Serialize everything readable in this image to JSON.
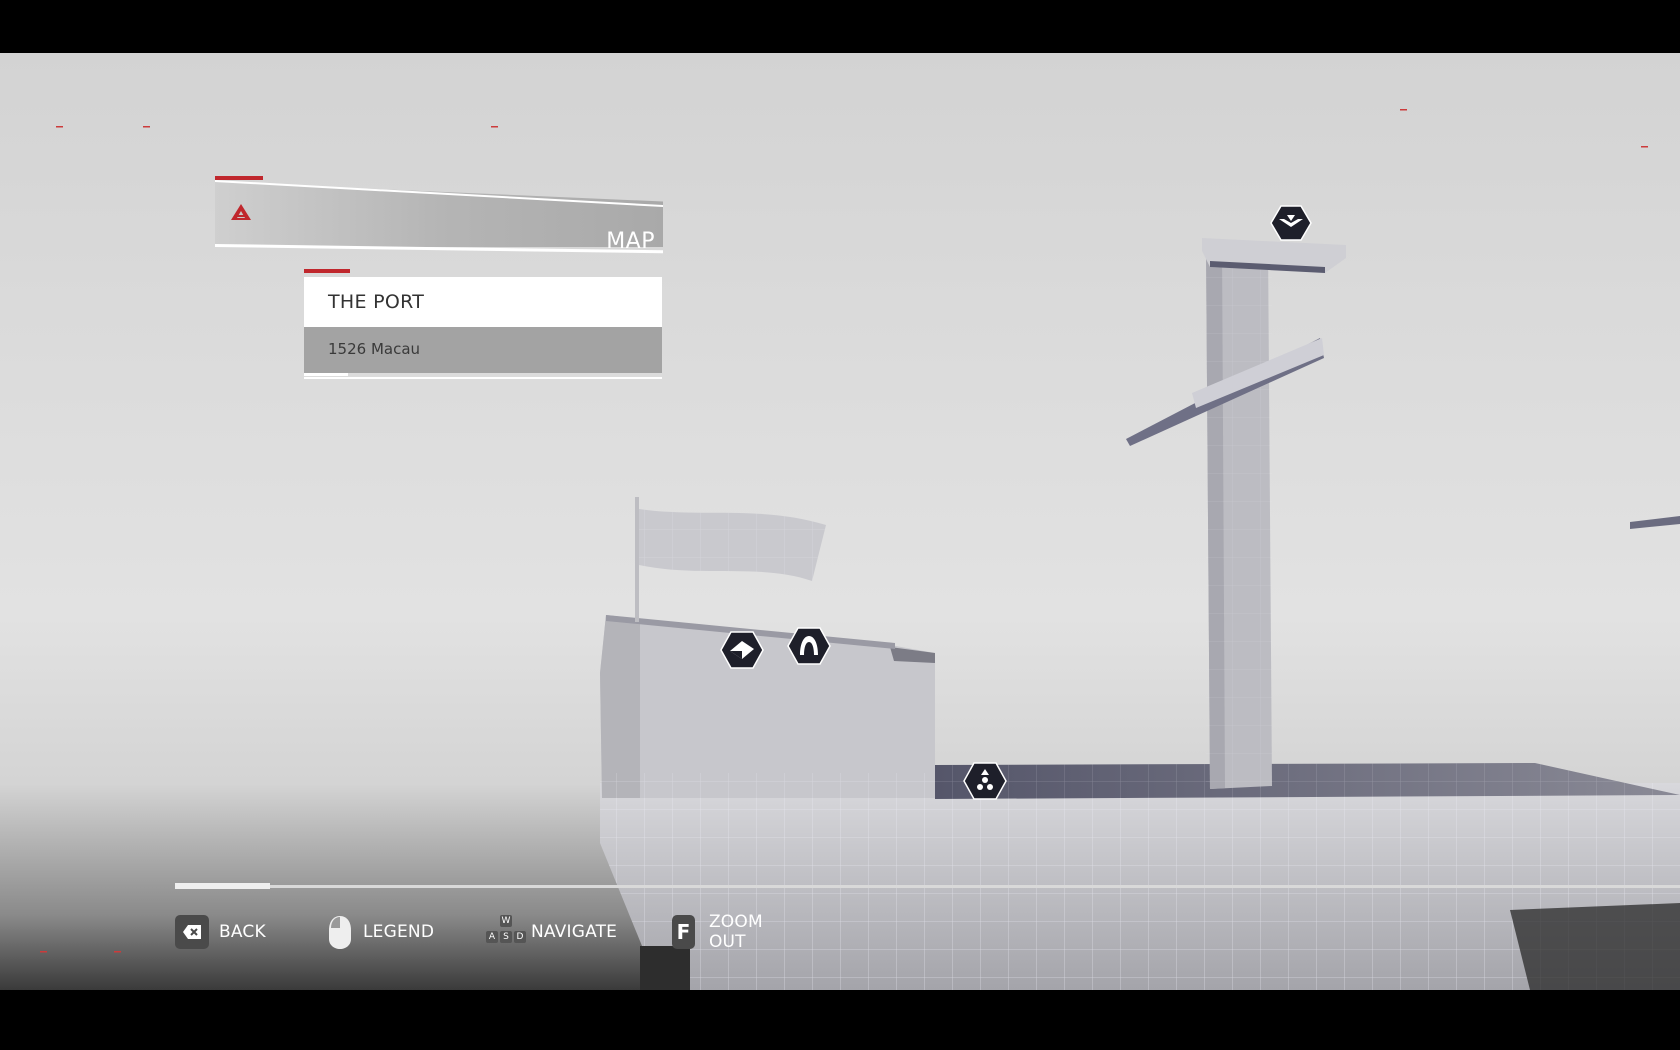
{
  "map_panel": {
    "title": "MAP",
    "logo_icon": "assassin-insignia-icon",
    "accent_color": "#c0272d"
  },
  "location": {
    "name": "THE PORT",
    "subtitle": "1526 Macau"
  },
  "controls": [
    {
      "key_icon": "backspace-key-icon",
      "label": "BACK"
    },
    {
      "key_icon": "mouse-icon",
      "label": "LEGEND"
    },
    {
      "key_icon": "wasd-keys-icon",
      "label": "NAVIGATE",
      "keys": [
        "W",
        "A",
        "S",
        "D"
      ]
    },
    {
      "key_icon": "f-key-icon",
      "key": "F",
      "label": "ZOOM OUT"
    }
  ],
  "map_markers": [
    {
      "icon": "viewpoint-eagle-icon"
    },
    {
      "icon": "collectible-fragment-icon"
    },
    {
      "icon": "hidden-hood-icon"
    },
    {
      "icon": "objective-group-icon"
    }
  ]
}
